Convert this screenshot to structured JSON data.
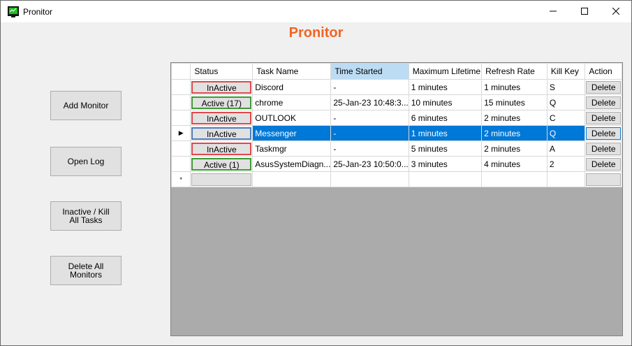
{
  "window": {
    "title": "Pronitor"
  },
  "heading": "Pronitor",
  "sidebar": {
    "add_monitor": "Add Monitor",
    "open_log": "Open Log",
    "inactive_kill_line1": "Inactive / Kill",
    "inactive_kill_line2": "All Tasks",
    "delete_all_line1": "Delete All",
    "delete_all_line2": "Monitors"
  },
  "grid": {
    "columns": [
      "Status",
      "Task Name",
      "Time Started",
      "Maximum Lifetime",
      "Refresh Rate",
      "Kill Key",
      "Action"
    ],
    "rows": [
      {
        "status": "InActive",
        "task": "Discord",
        "started": "-",
        "lifetime": "1 minutes",
        "refresh": "1 minutes",
        "key": "S",
        "action": "Delete"
      },
      {
        "status": "Active (17)",
        "task": "chrome",
        "started": "25-Jan-23 10:48:3...",
        "lifetime": "10 minutes",
        "refresh": "15 minutes",
        "key": "Q",
        "action": "Delete"
      },
      {
        "status": "InActive",
        "task": "OUTLOOK",
        "started": "-",
        "lifetime": "6 minutes",
        "refresh": "2 minutes",
        "key": "C",
        "action": "Delete"
      },
      {
        "status": "InActive",
        "task": "Messenger",
        "started": "-",
        "lifetime": "1 minutes",
        "refresh": "2 minutes",
        "key": "Q",
        "action": "Delete"
      },
      {
        "status": "InActive",
        "task": "Taskmgr",
        "started": "-",
        "lifetime": "5 minutes",
        "refresh": "2 minutes",
        "key": "A",
        "action": "Delete"
      },
      {
        "status": "Active (1)",
        "task": "AsusSystemDiagn...",
        "started": "25-Jan-23 10:50:0...",
        "lifetime": "3 minutes",
        "refresh": "4 minutes",
        "key": "2",
        "action": "Delete"
      }
    ],
    "current_row_marker": "▶",
    "new_row_marker": "*"
  },
  "colors": {
    "heading": "#f26522",
    "selection": "#0078d7",
    "active_border": "#3d9b35",
    "inactive_border": "#e0484d"
  },
  "icons": {
    "app": "monitor-icon",
    "minimize": "minimize-icon",
    "maximize": "maximize-icon",
    "close": "close-icon"
  }
}
